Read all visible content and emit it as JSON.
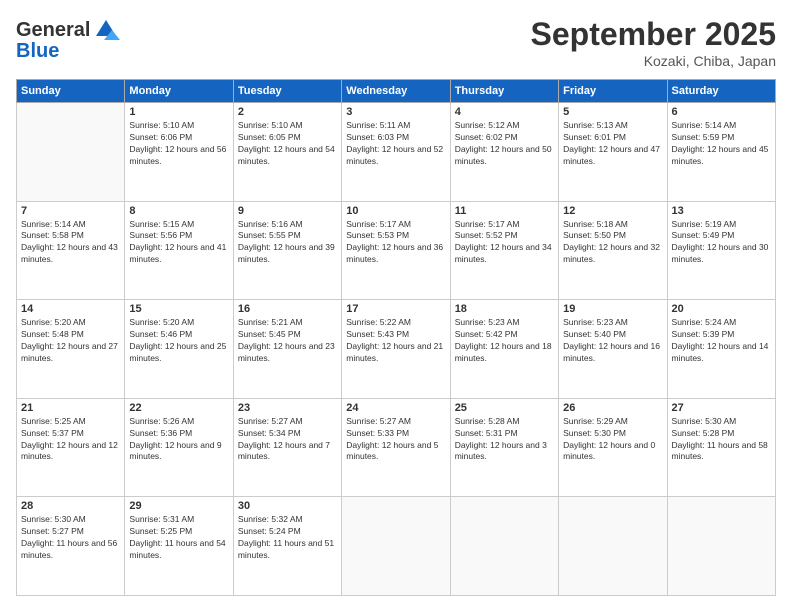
{
  "logo": {
    "line1": "General",
    "line2": "Blue"
  },
  "header": {
    "title": "September 2025",
    "location": "Kozaki, Chiba, Japan"
  },
  "weekdays": [
    "Sunday",
    "Monday",
    "Tuesday",
    "Wednesday",
    "Thursday",
    "Friday",
    "Saturday"
  ],
  "weeks": [
    [
      {
        "day": "",
        "sunrise": "",
        "sunset": "",
        "daylight": ""
      },
      {
        "day": "1",
        "sunrise": "Sunrise: 5:10 AM",
        "sunset": "Sunset: 6:06 PM",
        "daylight": "Daylight: 12 hours and 56 minutes."
      },
      {
        "day": "2",
        "sunrise": "Sunrise: 5:10 AM",
        "sunset": "Sunset: 6:05 PM",
        "daylight": "Daylight: 12 hours and 54 minutes."
      },
      {
        "day": "3",
        "sunrise": "Sunrise: 5:11 AM",
        "sunset": "Sunset: 6:03 PM",
        "daylight": "Daylight: 12 hours and 52 minutes."
      },
      {
        "day": "4",
        "sunrise": "Sunrise: 5:12 AM",
        "sunset": "Sunset: 6:02 PM",
        "daylight": "Daylight: 12 hours and 50 minutes."
      },
      {
        "day": "5",
        "sunrise": "Sunrise: 5:13 AM",
        "sunset": "Sunset: 6:01 PM",
        "daylight": "Daylight: 12 hours and 47 minutes."
      },
      {
        "day": "6",
        "sunrise": "Sunrise: 5:14 AM",
        "sunset": "Sunset: 5:59 PM",
        "daylight": "Daylight: 12 hours and 45 minutes."
      }
    ],
    [
      {
        "day": "7",
        "sunrise": "Sunrise: 5:14 AM",
        "sunset": "Sunset: 5:58 PM",
        "daylight": "Daylight: 12 hours and 43 minutes."
      },
      {
        "day": "8",
        "sunrise": "Sunrise: 5:15 AM",
        "sunset": "Sunset: 5:56 PM",
        "daylight": "Daylight: 12 hours and 41 minutes."
      },
      {
        "day": "9",
        "sunrise": "Sunrise: 5:16 AM",
        "sunset": "Sunset: 5:55 PM",
        "daylight": "Daylight: 12 hours and 39 minutes."
      },
      {
        "day": "10",
        "sunrise": "Sunrise: 5:17 AM",
        "sunset": "Sunset: 5:53 PM",
        "daylight": "Daylight: 12 hours and 36 minutes."
      },
      {
        "day": "11",
        "sunrise": "Sunrise: 5:17 AM",
        "sunset": "Sunset: 5:52 PM",
        "daylight": "Daylight: 12 hours and 34 minutes."
      },
      {
        "day": "12",
        "sunrise": "Sunrise: 5:18 AM",
        "sunset": "Sunset: 5:50 PM",
        "daylight": "Daylight: 12 hours and 32 minutes."
      },
      {
        "day": "13",
        "sunrise": "Sunrise: 5:19 AM",
        "sunset": "Sunset: 5:49 PM",
        "daylight": "Daylight: 12 hours and 30 minutes."
      }
    ],
    [
      {
        "day": "14",
        "sunrise": "Sunrise: 5:20 AM",
        "sunset": "Sunset: 5:48 PM",
        "daylight": "Daylight: 12 hours and 27 minutes."
      },
      {
        "day": "15",
        "sunrise": "Sunrise: 5:20 AM",
        "sunset": "Sunset: 5:46 PM",
        "daylight": "Daylight: 12 hours and 25 minutes."
      },
      {
        "day": "16",
        "sunrise": "Sunrise: 5:21 AM",
        "sunset": "Sunset: 5:45 PM",
        "daylight": "Daylight: 12 hours and 23 minutes."
      },
      {
        "day": "17",
        "sunrise": "Sunrise: 5:22 AM",
        "sunset": "Sunset: 5:43 PM",
        "daylight": "Daylight: 12 hours and 21 minutes."
      },
      {
        "day": "18",
        "sunrise": "Sunrise: 5:23 AM",
        "sunset": "Sunset: 5:42 PM",
        "daylight": "Daylight: 12 hours and 18 minutes."
      },
      {
        "day": "19",
        "sunrise": "Sunrise: 5:23 AM",
        "sunset": "Sunset: 5:40 PM",
        "daylight": "Daylight: 12 hours and 16 minutes."
      },
      {
        "day": "20",
        "sunrise": "Sunrise: 5:24 AM",
        "sunset": "Sunset: 5:39 PM",
        "daylight": "Daylight: 12 hours and 14 minutes."
      }
    ],
    [
      {
        "day": "21",
        "sunrise": "Sunrise: 5:25 AM",
        "sunset": "Sunset: 5:37 PM",
        "daylight": "Daylight: 12 hours and 12 minutes."
      },
      {
        "day": "22",
        "sunrise": "Sunrise: 5:26 AM",
        "sunset": "Sunset: 5:36 PM",
        "daylight": "Daylight: 12 hours and 9 minutes."
      },
      {
        "day": "23",
        "sunrise": "Sunrise: 5:27 AM",
        "sunset": "Sunset: 5:34 PM",
        "daylight": "Daylight: 12 hours and 7 minutes."
      },
      {
        "day": "24",
        "sunrise": "Sunrise: 5:27 AM",
        "sunset": "Sunset: 5:33 PM",
        "daylight": "Daylight: 12 hours and 5 minutes."
      },
      {
        "day": "25",
        "sunrise": "Sunrise: 5:28 AM",
        "sunset": "Sunset: 5:31 PM",
        "daylight": "Daylight: 12 hours and 3 minutes."
      },
      {
        "day": "26",
        "sunrise": "Sunrise: 5:29 AM",
        "sunset": "Sunset: 5:30 PM",
        "daylight": "Daylight: 12 hours and 0 minutes."
      },
      {
        "day": "27",
        "sunrise": "Sunrise: 5:30 AM",
        "sunset": "Sunset: 5:28 PM",
        "daylight": "Daylight: 11 hours and 58 minutes."
      }
    ],
    [
      {
        "day": "28",
        "sunrise": "Sunrise: 5:30 AM",
        "sunset": "Sunset: 5:27 PM",
        "daylight": "Daylight: 11 hours and 56 minutes."
      },
      {
        "day": "29",
        "sunrise": "Sunrise: 5:31 AM",
        "sunset": "Sunset: 5:25 PM",
        "daylight": "Daylight: 11 hours and 54 minutes."
      },
      {
        "day": "30",
        "sunrise": "Sunrise: 5:32 AM",
        "sunset": "Sunset: 5:24 PM",
        "daylight": "Daylight: 11 hours and 51 minutes."
      },
      {
        "day": "",
        "sunrise": "",
        "sunset": "",
        "daylight": ""
      },
      {
        "day": "",
        "sunrise": "",
        "sunset": "",
        "daylight": ""
      },
      {
        "day": "",
        "sunrise": "",
        "sunset": "",
        "daylight": ""
      },
      {
        "day": "",
        "sunrise": "",
        "sunset": "",
        "daylight": ""
      }
    ]
  ]
}
